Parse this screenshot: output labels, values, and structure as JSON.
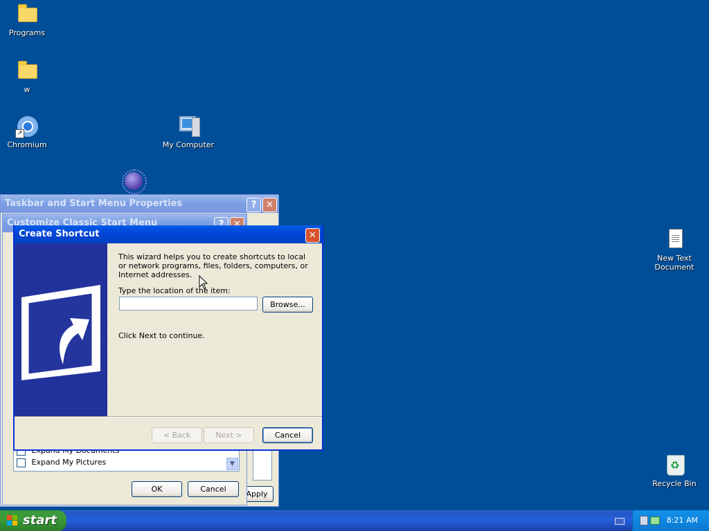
{
  "desktop": {
    "icons": [
      {
        "label": "Programs"
      },
      {
        "label": "w"
      },
      {
        "label": "Chromium"
      },
      {
        "label": "My Computer"
      },
      {
        "label": "New Text Document"
      },
      {
        "label": "Recycle Bin"
      }
    ]
  },
  "taskbar_props": {
    "title": "Taskbar and Start Menu Properties",
    "apply_label": "Apply"
  },
  "customize": {
    "title": "Customize Classic Start Menu",
    "items": [
      {
        "label": "Expand My Documents",
        "checked": false
      },
      {
        "label": "Expand My Pictures",
        "checked": false
      }
    ],
    "ok_label": "OK",
    "cancel_label": "Cancel"
  },
  "wizard": {
    "title": "Create Shortcut",
    "intro": "This wizard helps you to create shortcuts to local or network programs, files, folders, computers, or Internet addresses.",
    "location_label": "Type the location of the item:",
    "location_value": "",
    "browse_label": "Browse...",
    "continue_text": "Click Next to continue.",
    "back_label": "< Back",
    "next_label": "Next >",
    "cancel_label": "Cancel"
  },
  "taskbar": {
    "start_label": "start",
    "clock": "8:21 AM"
  },
  "colors": {
    "desktop": "#004e98",
    "title_active": "#0343d4",
    "start_green": "#3a9c38"
  }
}
